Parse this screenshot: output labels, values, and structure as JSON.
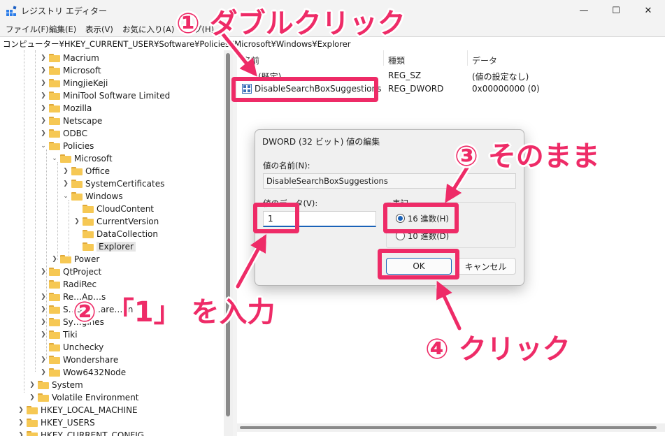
{
  "window": {
    "title": "レジストリ エディター",
    "minimize": "—",
    "maximize": "☐",
    "close": "✕"
  },
  "menu": [
    "ファイル(F)",
    "編集(E)",
    "表示(V)",
    "お気に入り(A)",
    "ヘルプ(H)"
  ],
  "address": "コンピューター¥HKEY_CURRENT_USER¥Software¥Policies¥Microsoft¥Windows¥Explorer",
  "tree": [
    {
      "label": "Macrium",
      "expanded": false
    },
    {
      "label": "Microsoft",
      "expanded": false
    },
    {
      "label": "MingjieKeji",
      "expanded": false
    },
    {
      "label": "MiniTool Software Limited",
      "expanded": false
    },
    {
      "label": "Mozilla",
      "expanded": false
    },
    {
      "label": "Netscape",
      "expanded": false
    },
    {
      "label": "ODBC",
      "expanded": false
    },
    {
      "label": "Policies",
      "expanded": true
    },
    {
      "label": "Microsoft",
      "expanded": true
    },
    {
      "label": "Office",
      "expanded": false
    },
    {
      "label": "SystemCertificates",
      "expanded": false
    },
    {
      "label": "Windows",
      "expanded": true
    },
    {
      "label": "CloudContent",
      "expanded": false
    },
    {
      "label": "CurrentVersion",
      "expanded": false
    },
    {
      "label": "DataCollection",
      "expanded": false
    },
    {
      "label": "Explorer",
      "expanded": false,
      "selected": true
    },
    {
      "label": "Power",
      "expanded": false
    },
    {
      "label": "QtProject",
      "expanded": false
    },
    {
      "label": "RadiRec",
      "expanded": false
    },
    {
      "label": "Re…Ap…s",
      "expanded": false
    },
    {
      "label": "S…Spy…are…on",
      "expanded": false
    },
    {
      "label": "Sy…gines",
      "expanded": false
    },
    {
      "label": "Tiki",
      "expanded": false
    },
    {
      "label": "Unchecky",
      "expanded": false
    },
    {
      "label": "Wondershare",
      "expanded": false
    },
    {
      "label": "Wow6432Node",
      "expanded": false
    },
    {
      "label": "System",
      "expanded": false
    },
    {
      "label": "Volatile Environment",
      "expanded": false
    },
    {
      "label": "HKEY_LOCAL_MACHINE",
      "expanded": false
    },
    {
      "label": "HKEY_USERS",
      "expanded": false
    },
    {
      "label": "HKEY_CURRENT_CONFIG",
      "expanded": false
    }
  ],
  "values_pane": {
    "columns": [
      "名前",
      "種類",
      "データ"
    ],
    "rows": [
      {
        "name": "(既定)",
        "type": "REG_SZ",
        "data": "(値の設定なし)"
      },
      {
        "name": "DisableSearchBoxSuggestions",
        "type": "REG_DWORD",
        "data": "0x00000000 (0)"
      }
    ]
  },
  "dialog": {
    "title": "DWORD (32 ビット) 値の編集",
    "name_label": "値の名前(N):",
    "name_value": "DisableSearchBoxSuggestions",
    "data_label": "値のデータ(V):",
    "data_value": "1",
    "radix_label": "表記",
    "radix_hex": "16 進数(H)",
    "radix_dec": "10 進数(D)",
    "ok": "OK",
    "cancel": "キャンセル"
  },
  "annotations": {
    "step1": "① ダブルクリック",
    "step2": "② 「1」 を入力",
    "step3": "③ そのまま",
    "step4": "④ クリック",
    "color": "#ee2b67"
  }
}
